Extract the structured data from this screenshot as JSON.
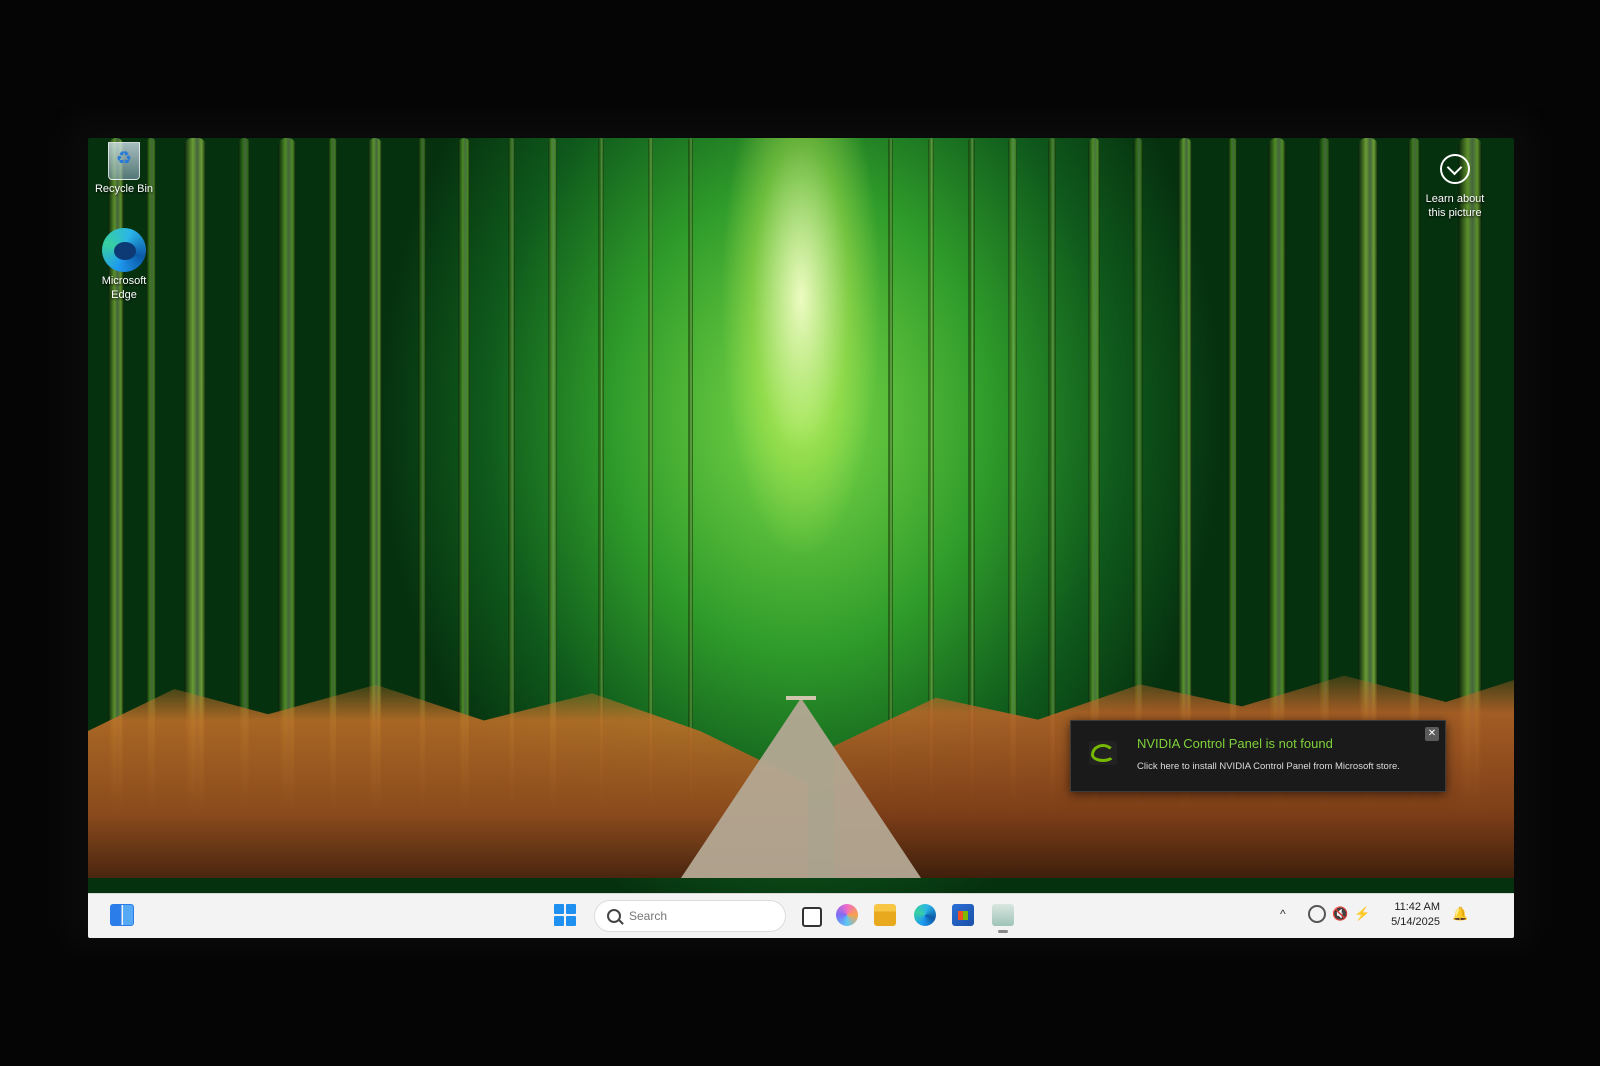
{
  "desktop": {
    "icons": [
      {
        "label": "Recycle Bin",
        "icon": "recycle-bin-icon"
      },
      {
        "label": "Microsoft\nEdge",
        "icon": "edge-icon"
      }
    ],
    "learn_about": {
      "line1": "Learn about",
      "line2": "this picture",
      "icon": "info-compass-icon"
    }
  },
  "notification": {
    "title": "NVIDIA Control Panel is not found",
    "body": "Click here to install NVIDIA Control Panel from Microsoft store.",
    "close": "✕",
    "accent": "#76b900"
  },
  "taskbar": {
    "search_placeholder": "Search",
    "pinned": [
      "task-view",
      "copilot",
      "file-explorer",
      "microsoft-edge",
      "microsoft-store",
      "nvidia-app"
    ],
    "tray": {
      "chevron": "^",
      "time": "11:42 AM",
      "date": "5/14/2025"
    }
  }
}
